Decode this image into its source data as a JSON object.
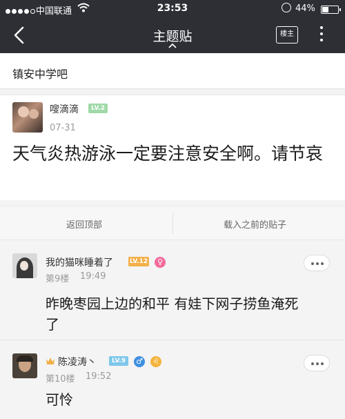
{
  "status": {
    "carrier": "中国联通",
    "time": "23:53",
    "battery_pct": "44%",
    "battery_level": 0.44
  },
  "nav": {
    "title": "主题贴",
    "owner_label": "楼主",
    "back_icon": "back-chevron-icon",
    "more_icon": "vertical-ellipsis-icon"
  },
  "forum": {
    "name": "镇安中学吧"
  },
  "main_post": {
    "author": "嗖滴滴",
    "level": "LV.2",
    "date": "07-31",
    "text": "天气炎热游泳一定要注意安全啊。请节哀"
  },
  "actions": {
    "back_top": "返回顶部",
    "load_previous": "载入之前的贴子"
  },
  "replies": [
    {
      "author": "我的猫咪睡着了",
      "level": "LV.12",
      "gender": "♀",
      "floor": "第9楼",
      "time": "19:49",
      "text_line1": "昨晚枣园上边的和平 有娃下网子捞鱼淹死",
      "text_line2": "了"
    },
    {
      "author": "陈凌涛丶",
      "level": "LV.9",
      "gender": "♂",
      "zodiac": "♌",
      "floor": "第10楼",
      "time": "19:52",
      "text": "可怜"
    }
  ],
  "colors": {
    "header_bg": "#2d2f35",
    "lv_green": "#9fd9a7",
    "lv_gold": "#f2b04a",
    "lv_blue": "#7ec7ea",
    "female": "#f26b9b",
    "male": "#3e8fe0"
  }
}
